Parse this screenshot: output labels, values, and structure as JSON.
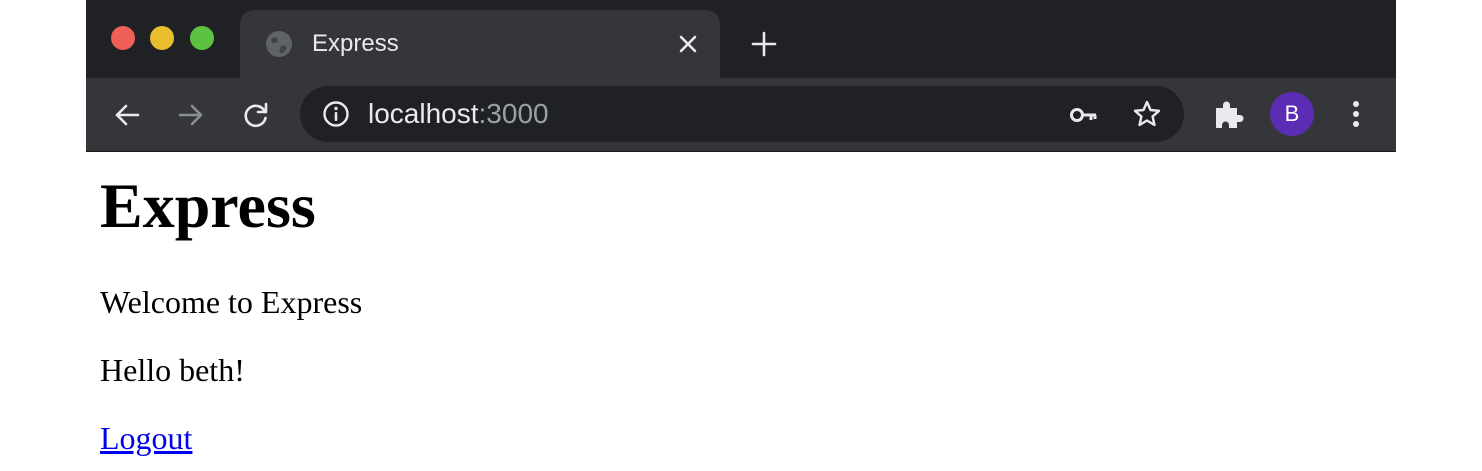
{
  "browser": {
    "tab": {
      "title": "Express",
      "favicon": "globe-icon"
    },
    "toolbar": {
      "url_host": "localhost",
      "url_port": ":3000",
      "profile_initial": "B",
      "profile_color": "#5b2db5"
    },
    "icons": {
      "back": "arrow-left-icon",
      "forward": "arrow-right-icon",
      "reload": "reload-icon",
      "info": "info-icon",
      "key": "key-icon",
      "star": "star-icon",
      "extensions": "puzzle-icon",
      "menu": "more-vert-icon",
      "close_tab": "close-icon",
      "new_tab": "plus-icon"
    }
  },
  "page": {
    "heading": "Express",
    "welcome": "Welcome to Express",
    "greeting": "Hello beth!",
    "logout_link": "Logout"
  },
  "colors": {
    "titlebar": "#202124",
    "toolbar": "#35363a",
    "link": "#0000ee"
  }
}
